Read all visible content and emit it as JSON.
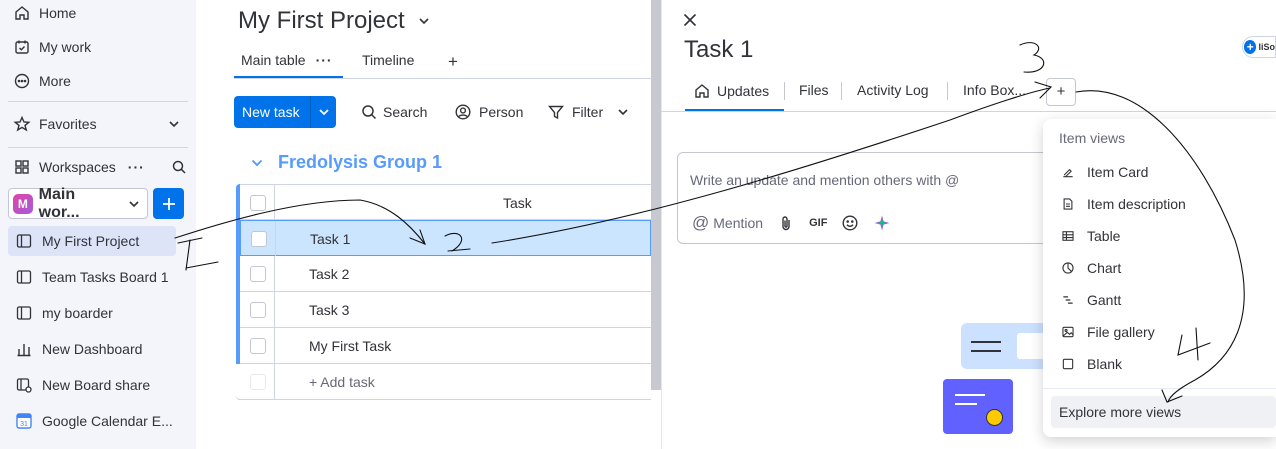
{
  "sidebar": {
    "nav": [
      {
        "label": "Home",
        "icon": "home-icon"
      },
      {
        "label": "My work",
        "icon": "calendar-check-icon"
      },
      {
        "label": "More",
        "icon": "more-circle-icon"
      }
    ],
    "favorites_label": "Favorites",
    "workspaces_label": "Workspaces",
    "workspace_badge": "M",
    "workspace_name": "Main wor...",
    "boards": [
      {
        "label": "My First Project",
        "icon": "board-icon",
        "active": true
      },
      {
        "label": "Team Tasks Board 1",
        "icon": "board-icon"
      },
      {
        "label": "my boarder",
        "icon": "board-icon"
      },
      {
        "label": "New Dashboard",
        "icon": "dashboard-icon"
      },
      {
        "label": "New Board share",
        "icon": "board-share-icon"
      },
      {
        "label": "Google Calendar E...",
        "icon": "google-calendar-icon"
      }
    ]
  },
  "board": {
    "title": "My First Project",
    "tabs": {
      "main": "Main table",
      "timeline": "Timeline",
      "add": "+"
    },
    "toolbar": {
      "new_task": "New task",
      "search": "Search",
      "person": "Person",
      "filter": "Filter"
    },
    "group": {
      "name": "Fredolysis Group 1",
      "color": "#579bfc"
    },
    "column_header": "Task",
    "rows": [
      "Task 1",
      "Task 2",
      "Task 3",
      "My First Task"
    ],
    "add_task": "+ Add task"
  },
  "panel": {
    "title": "Task 1",
    "tabs": [
      "Updates",
      "Files",
      "Activity Log",
      "Info Box..."
    ],
    "add_tab": "+",
    "editor_placeholder": "Write an update and mention others with @",
    "mention_label": "Mention",
    "gif_label": "GIF",
    "avatar_text": "liSo",
    "dropdown": {
      "header": "Item views",
      "items": [
        {
          "label": "Item Card",
          "icon": "item-card-icon"
        },
        {
          "label": "Item description",
          "icon": "document-icon"
        },
        {
          "label": "Table",
          "icon": "table-icon"
        },
        {
          "label": "Chart",
          "icon": "chart-icon"
        },
        {
          "label": "Gantt",
          "icon": "gantt-icon"
        },
        {
          "label": "File gallery",
          "icon": "image-icon"
        },
        {
          "label": "Blank",
          "icon": "blank-icon"
        }
      ],
      "footer": "Explore more views"
    }
  },
  "annotations": [
    "1",
    "2",
    "3",
    "4"
  ],
  "colors": {
    "primary": "#0073ea",
    "selected_row": "#cce5ff",
    "sidebar_bg": "#f3f5fb"
  }
}
